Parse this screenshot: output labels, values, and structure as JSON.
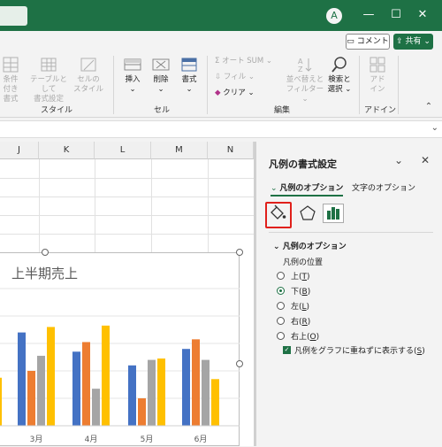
{
  "titlebar": {
    "avatar_glyph": "A",
    "minimize": "—",
    "maximize": "☐",
    "close": "✕"
  },
  "header_actions": {
    "comment_label": "コメント",
    "share_label": "共有"
  },
  "ribbon": {
    "style_group": {
      "label": "スタイル",
      "conditional_format": [
        "条件付き",
        "書式"
      ],
      "table_format": [
        "テーブルとして",
        "書式設定"
      ],
      "cell_style": [
        "セルの",
        "スタイル"
      ]
    },
    "cells_group": {
      "label": "セル",
      "insert": "挿入",
      "delete": "削除",
      "format": "書式"
    },
    "edit_group": {
      "label": "編集",
      "autosum": "オート SUM",
      "fill": "フィル",
      "clear": "クリア",
      "sort_filter": [
        "並べ替えと",
        "フィルター"
      ],
      "find_select": [
        "検索と",
        "選択"
      ]
    },
    "addin_group": {
      "label": "アドイン",
      "addin": [
        "アド",
        "イン"
      ]
    }
  },
  "sheet": {
    "columns": [
      "J",
      "K",
      "L",
      "M",
      "N"
    ]
  },
  "chart_data": {
    "type": "bar",
    "title": "上半期売上",
    "categories": [
      "3月",
      "4月",
      "5月",
      "6月"
    ],
    "series_colors": [
      "#4472c4",
      "#ed7d31",
      "#a5a5a5",
      "#ffc000"
    ],
    "series": [
      {
        "values": [
          68,
          54,
          44,
          56
        ]
      },
      {
        "values": [
          40,
          61,
          20,
          63
        ]
      },
      {
        "values": [
          51,
          27,
          48,
          48
        ]
      },
      {
        "values": [
          72,
          73,
          49,
          34
        ]
      }
    ],
    "ylim": [
      0,
      100
    ],
    "partial_left_value": 35,
    "xlabel": "",
    "ylabel": ""
  },
  "panel": {
    "title": "凡例の書式設定",
    "tab_legend_options": "凡例のオプション",
    "tab_text_options": "文字のオプション",
    "section_title": "凡例のオプション",
    "position_label": "凡例の位置",
    "positions": [
      {
        "label": "上",
        "key": "T",
        "selected": false
      },
      {
        "label": "下",
        "key": "B",
        "selected": true
      },
      {
        "label": "左",
        "key": "L",
        "selected": false
      },
      {
        "label": "右",
        "key": "R",
        "selected": false
      },
      {
        "label": "右上",
        "key": "O",
        "selected": false
      }
    ],
    "overlap_label": "凡例をグラフに重ねずに表示する",
    "overlap_key": "S",
    "overlap_checked": true
  }
}
